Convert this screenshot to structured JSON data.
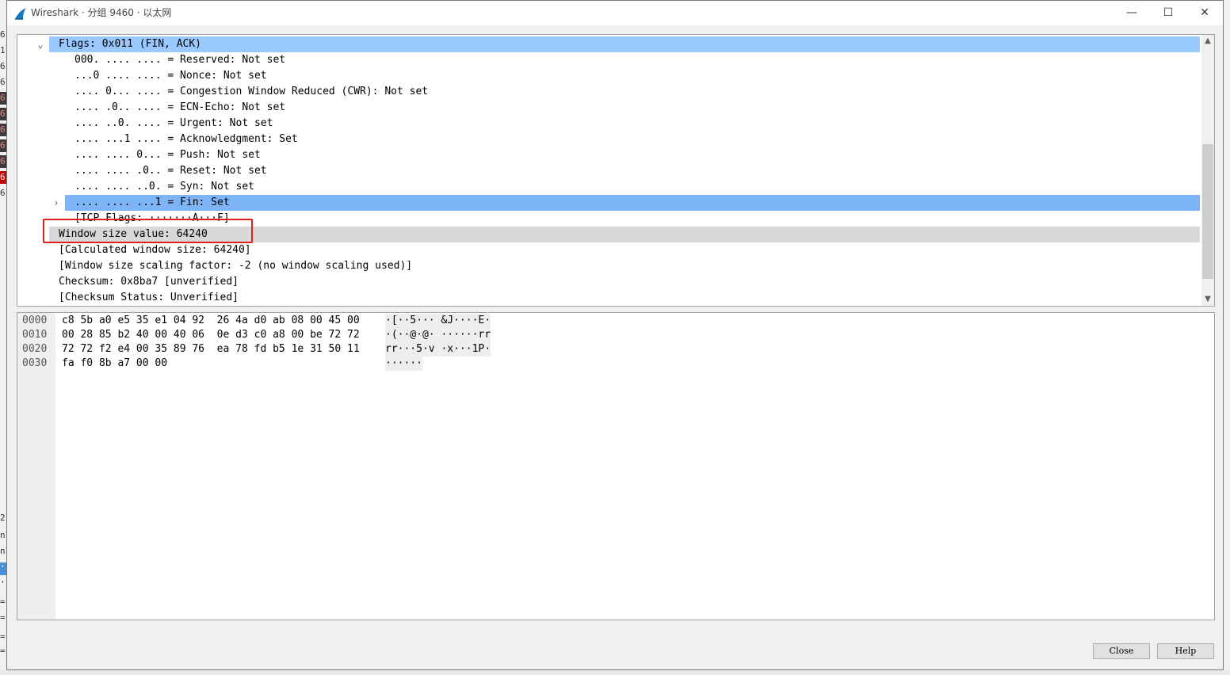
{
  "window": {
    "title": "Wireshark · 分组 9460 · 以太网",
    "minimize_glyph": "—",
    "maximize_glyph": "☐",
    "close_glyph": "✕"
  },
  "background_app": {
    "left_chars": [
      "6",
      "1",
      "6",
      "6",
      "6",
      "6",
      "6",
      "6",
      "6",
      "6",
      "6",
      "2",
      "nl",
      "nl",
      "'",
      "'",
      "=",
      "=",
      "=",
      "="
    ]
  },
  "details": {
    "rows": [
      {
        "text": "Flags: 0x011 (FIN, ACK)",
        "expanded": true,
        "selected": true
      },
      {
        "text": "000. .... .... = Reserved: Not set"
      },
      {
        "text": "...0 .... .... = Nonce: Not set"
      },
      {
        "text": ".... 0... .... = Congestion Window Reduced (CWR): Not set"
      },
      {
        "text": ".... .0.. .... = ECN-Echo: Not set"
      },
      {
        "text": ".... ..0. .... = Urgent: Not set"
      },
      {
        "text": ".... ...1 .... = Acknowledgment: Set"
      },
      {
        "text": ".... .... 0... = Push: Not set"
      },
      {
        "text": ".... .... .0.. = Reset: Not set"
      },
      {
        "text": ".... .... ..0. = Syn: Not set"
      },
      {
        "text": ".... .... ...1 = Fin: Set",
        "expandable": true,
        "selected": true
      },
      {
        "text": "[TCP Flags: ·······A···F]"
      },
      {
        "text": "Window size value: 64240",
        "highlighted": true
      },
      {
        "text": "[Calculated window size: 64240]"
      },
      {
        "text": "[Window size scaling factor: -2 (no window scaling used)]"
      },
      {
        "text": "Checksum: 0x8ba7 [unverified]"
      },
      {
        "text": "[Checksum Status: Unverified]"
      }
    ],
    "scroll_up": "▲",
    "scroll_down": "▼"
  },
  "bytes": {
    "lines": [
      {
        "offset": "0000",
        "hex": "c8 5b a0 e5 35 e1 04 92  26 4a d0 ab 08 00 45 00",
        "ascii": "·[··5··· &J····E·"
      },
      {
        "offset": "0010",
        "hex": "00 28 85 b2 40 00 40 06  0e d3 c0 a8 00 be 72 72",
        "ascii": "·(··@·@· ······rr"
      },
      {
        "offset": "0020",
        "hex": "72 72 f2 e4 00 35 89 76  ea 78 fd b5 1e 31 50 11",
        "ascii": "rr···5·v ·x···1P·"
      },
      {
        "offset": "0030",
        "hex": "fa f0 8b a7 00 00",
        "ascii": "······"
      }
    ]
  },
  "buttons": {
    "close": "Close",
    "help": "Help"
  },
  "colors": {
    "selection": "#99c9ff",
    "highlight": "#d8d8d8",
    "annotation_box": "#e0201a"
  }
}
